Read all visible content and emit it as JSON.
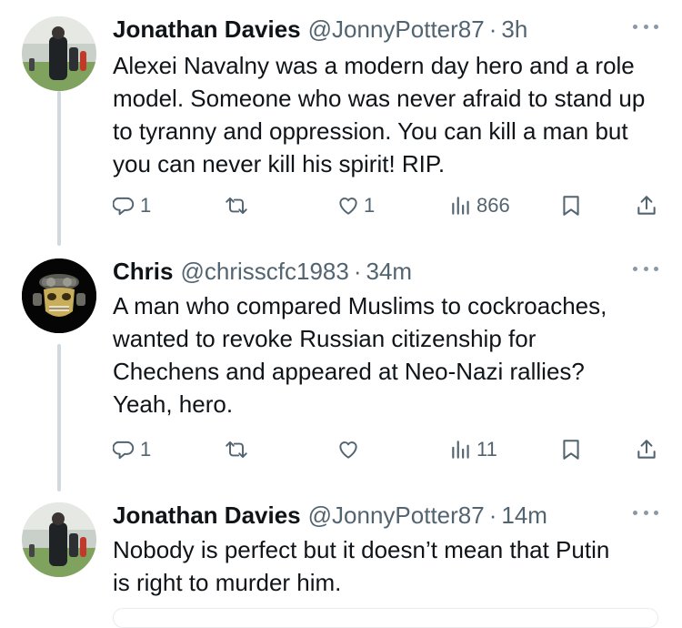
{
  "tweets": [
    {
      "name": "Jonathan Davies",
      "handle": "@JonnyPotter87",
      "sep": "·",
      "time": "3h",
      "text": "Alexei Navalny was a modern day hero and a role model. Someone who was never afraid to stand up to tyranny and oppression. You can kill a man but you can never kill his spirit! RIP.",
      "replies": "1",
      "retweets": "",
      "likes": "1",
      "views": "866"
    },
    {
      "name": "Chris",
      "handle": "@chrisscfc1983",
      "sep": "·",
      "time": "34m",
      "text": "A man who compared Muslims to cockroaches, wanted to revoke Russian citizenship for Chechens and appeared at Neo-Nazi rallies? Yeah, hero.",
      "replies": "1",
      "retweets": "",
      "likes": "",
      "views": "11"
    },
    {
      "name": "Jonathan Davies",
      "handle": "@JonnyPotter87",
      "sep": "·",
      "time": "14m",
      "text": "Nobody is perfect but it doesn’t mean that Putin is right to murder him."
    }
  ],
  "icons": {
    "reply": "reply-icon",
    "retweet": "retweet-icon",
    "like": "heart-icon",
    "views": "views-bar-chart-icon",
    "bookmark": "bookmark-icon",
    "share": "share-icon",
    "more": "more-dots-icon"
  },
  "colors": {
    "text": "#0f1419",
    "secondary": "#536471",
    "thread_line": "#cfd9de"
  }
}
